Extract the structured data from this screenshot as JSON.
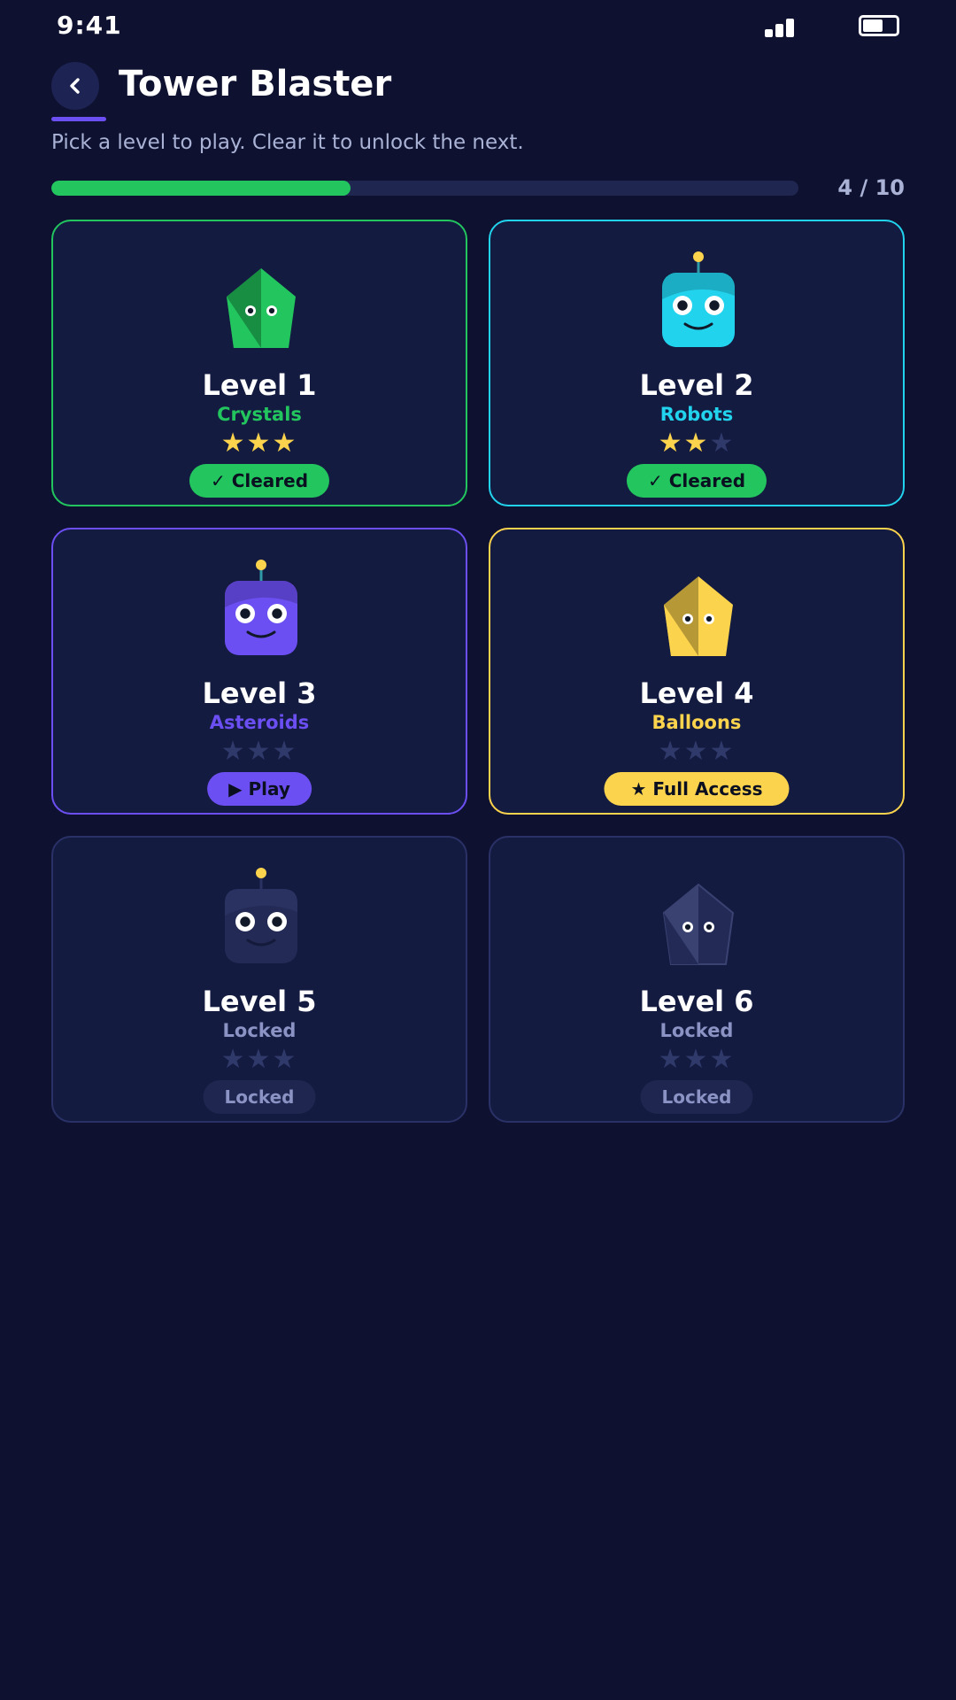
{
  "status_bar": {
    "time": "9:41",
    "battery_level": 0.6
  },
  "header": {
    "title": "Tower Blaster",
    "back_icon": "chevron-left-icon"
  },
  "subtitle": "Pick a level to play. Clear it to unlock the next.",
  "progress": {
    "cleared": 4,
    "total": 10,
    "label": "4 / 10",
    "fraction": 0.4
  },
  "colors": {
    "accent": "#6c4ff2",
    "cleared": "#22c55e",
    "star_filled": "#fcd34d",
    "star_empty": "#2f3a6b",
    "background": "#0e1230",
    "card": "#141b40"
  },
  "levels": [
    {
      "title": "Level 1",
      "theme": "Crystals",
      "icon": "crystal-icon",
      "color": "#22c55e",
      "stars": 3,
      "status": "cleared",
      "action_label": "✓ Cleared"
    },
    {
      "title": "Level 2",
      "theme": "Robots",
      "icon": "robot-icon",
      "color": "#22d3ee",
      "stars": 2,
      "status": "cleared",
      "action_label": "✓ Cleared"
    },
    {
      "title": "Level 3",
      "theme": "Asteroids",
      "icon": "robot-icon",
      "color": "#6c4ff2",
      "stars": 0,
      "status": "play",
      "action_label": "▶ Play"
    },
    {
      "title": "Level 4",
      "theme": "Balloons",
      "icon": "crystal-icon",
      "color": "#fcd34d",
      "stars": 0,
      "status": "premium",
      "action_label": "★ Full Access"
    },
    {
      "title": "Level 5",
      "theme": "Locked",
      "icon": "robot-icon",
      "color": "#8a93c4",
      "stars": 0,
      "status": "locked",
      "action_label": "Locked"
    },
    {
      "title": "Level 6",
      "theme": "Locked",
      "icon": "crystal-icon",
      "color": "#8a93c4",
      "stars": 0,
      "status": "locked",
      "action_label": "Locked"
    }
  ]
}
